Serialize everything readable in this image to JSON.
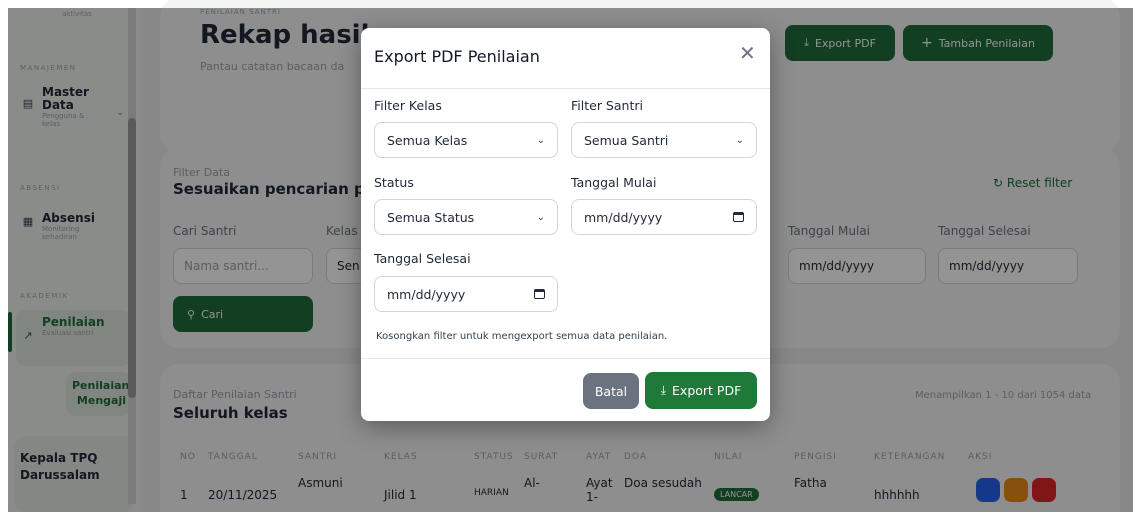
{
  "sidebar": {
    "top_label": "aktivitas",
    "sections": {
      "manajemen": "MANAJEMEN",
      "absensi": "ABSENSI",
      "akademik": "AKADEMIK"
    },
    "items": [
      {
        "title": "Master Data",
        "subtitle": "Pengguna & kelas",
        "icon": "file-icon"
      },
      {
        "title": "Absensi",
        "subtitle": "Monitoring kehadiran",
        "icon": "calendar-icon"
      },
      {
        "title": "Penilaian",
        "subtitle": "Evaluasi santri",
        "icon": "chart-icon"
      }
    ],
    "subitem": "Penilaian Mengaji",
    "footer": "Kepala TPQ Darussalam"
  },
  "page": {
    "eyebrow": "PENILAIAN SANTRI",
    "title": "Rekap hasil p",
    "subtitle": "Pantau catatan bacaan da",
    "export_button": "Export PDF",
    "add_button": "Tambah Penilaian"
  },
  "filter": {
    "eyebrow": "Filter Data",
    "title": "Sesuaikan pencarian pe",
    "reset": "Reset filter",
    "cari_santri_label": "Cari Santri",
    "cari_placeholder": "Nama santri...",
    "kelas_label": "Kelas",
    "kelas_value": "Sen",
    "tanggal_mulai_label": "Tanggal Mulai",
    "tanggal_mulai_value": "mm/dd/yyyy",
    "tanggal_selesai_label": "Tanggal Selesai",
    "tanggal_selesai_value": "mm/dd/yyyy",
    "search_button": "Cari"
  },
  "list": {
    "eyebrow": "Daftar Penilaian Santri",
    "title": "Seluruh kelas",
    "count": "Menampilkan 1 - 10 dari 1054 data",
    "columns": [
      "NO",
      "TANGGAL",
      "SANTRI",
      "KELAS",
      "STATUS",
      "SURAT",
      "AYAT",
      "DOA",
      "NILAI",
      "PENGISI",
      "KETERANGAN",
      "AKSI"
    ],
    "row": {
      "no": "1",
      "tanggal": "20/11/2025",
      "santri": "Asmuni",
      "kelas": "Jilid 1",
      "status": "HARIAN",
      "surat": "Al-",
      "ayat": "Ayat 1-",
      "doa": "Doa sesudah",
      "nilai": "LANCAR",
      "pengisi": "Fatha",
      "keterangan": "hhhhhh"
    }
  },
  "modal": {
    "title": "Export PDF Penilaian",
    "filter_kelas_label": "Filter Kelas",
    "filter_kelas_value": "Semua Kelas",
    "filter_santri_label": "Filter Santri",
    "filter_santri_value": "Semua Santri",
    "status_label": "Status",
    "status_value": "Semua Status",
    "tanggal_mulai_label": "Tanggal Mulai",
    "tanggal_mulai_value": "mm/dd/yyyy",
    "tanggal_selesai_label": "Tanggal Selesai",
    "tanggal_selesai_value": "mm/dd/yyyy",
    "hint": "Kosongkan filter untuk mengexport semua data penilaian.",
    "cancel_button": "Batal",
    "export_button": "Export PDF"
  },
  "colors": {
    "primary_green": "#1f7a3a",
    "cancel_gray": "#6b7280"
  }
}
